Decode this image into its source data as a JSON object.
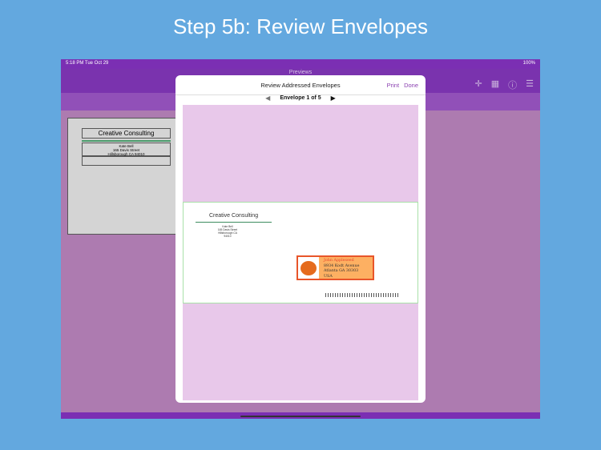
{
  "headline": "Step 5b: Review Envelopes",
  "status": {
    "time": "5:18 PM  Tue Oct 29",
    "battery": "100%"
  },
  "nav": {
    "title": "Previews",
    "icons": [
      "move-icon",
      "grid-icon",
      "help-icon",
      "list-icon"
    ]
  },
  "card": {
    "company": "Creative Consulting",
    "address": [
      "Kate Bell",
      "165 Davis Street",
      "Hillsborough CA 94010"
    ]
  },
  "modal": {
    "title": "Review Addressed Envelopes",
    "print": "Print",
    "done": "Done",
    "pager": "Envelope 1 of 5"
  },
  "envelope": {
    "company": "Creative Consulting",
    "return_address": [
      "Kate Bell",
      "165 Davis Street",
      "Hillsborough CA 94010"
    ],
    "recipient": [
      "John Appleseed",
      "8934 Kodt Avenue",
      "Atlanta GA 30303",
      "USA"
    ]
  },
  "colors": {
    "accent": "#8a3fb0",
    "background": "#63a8df"
  }
}
